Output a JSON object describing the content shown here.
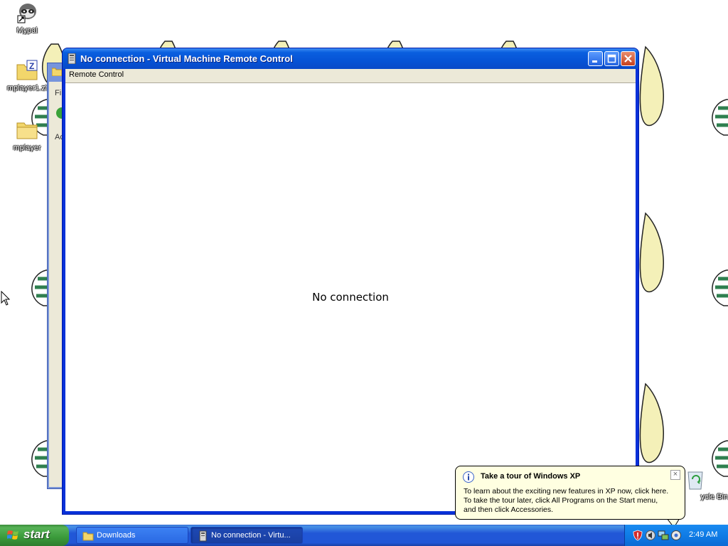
{
  "desktop": {
    "icons": [
      {
        "label": "Mypal",
        "icon": "raccoon-browser-icon"
      },
      {
        "label": "mplayer1.zi",
        "icon": "zip-folder-icon"
      },
      {
        "label": "mplayer",
        "icon": "folder-icon"
      },
      {
        "label": "ycle Bin",
        "icon": "recycle-bin-icon"
      }
    ]
  },
  "background_window": {
    "fragments": [
      "Fi",
      "Ac"
    ]
  },
  "window": {
    "title": "No connection - Virtual Machine Remote Control",
    "menu": [
      "Remote Control"
    ],
    "status_message": "No connection",
    "buttons": {
      "minimize": "minimize",
      "maximize": "maximize",
      "close": "close"
    }
  },
  "balloon": {
    "title": "Take a tour of Windows XP",
    "lines": [
      "To learn about the exciting new features in XP now, click here.",
      "To take the tour later, click All Programs on the Start menu,",
      "and then click Accessories."
    ],
    "close_glyph": "×"
  },
  "taskbar": {
    "start_label": "start",
    "tasks": [
      {
        "label": "Downloads",
        "icon": "folder-icon",
        "active": false
      },
      {
        "label": "No connection - Virtu...",
        "icon": "vm-icon",
        "active": true
      }
    ],
    "tray_icons": [
      "shield-alert-icon",
      "volume-icon",
      "network-icon",
      "tour-icon"
    ],
    "clock": "2:49 AM"
  },
  "colors": {
    "titlebar": "#0653d6",
    "taskbar": "#2157d7",
    "start": "#3a9a3a",
    "balloon": "#ffffe1",
    "client": "#ffffff"
  }
}
